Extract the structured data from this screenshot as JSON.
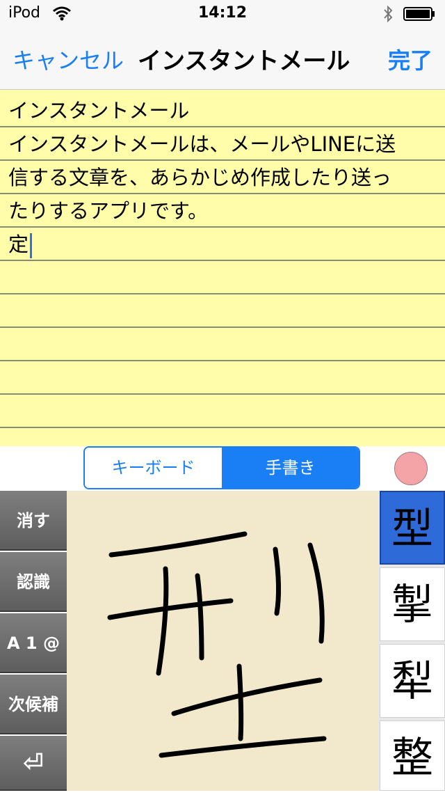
{
  "status": {
    "carrier": "iPod",
    "time": "14:12"
  },
  "nav": {
    "cancel": "キャンセル",
    "title": "インスタントメール",
    "done": "完了"
  },
  "note_lines": [
    "インスタントメール",
    "インスタントメールは、メールやLINEに送",
    "信する文章を、あらかじめ作成したり送っ",
    "たりするアプリです。",
    "定"
  ],
  "segment": {
    "keyboard": "キーボード",
    "handwriting": "手書き",
    "selected": "手書き"
  },
  "keys": [
    "消す",
    "認識",
    "A 1 @",
    "次候補",
    "⏎"
  ],
  "candidates": [
    "型",
    "掣",
    "犁",
    "整"
  ],
  "colors": {
    "accent": "#1a7ef5",
    "note_bg": "#fffcaa",
    "pad_bg": "#f2e9cc",
    "selected_candidate": "#2f6ad9"
  }
}
